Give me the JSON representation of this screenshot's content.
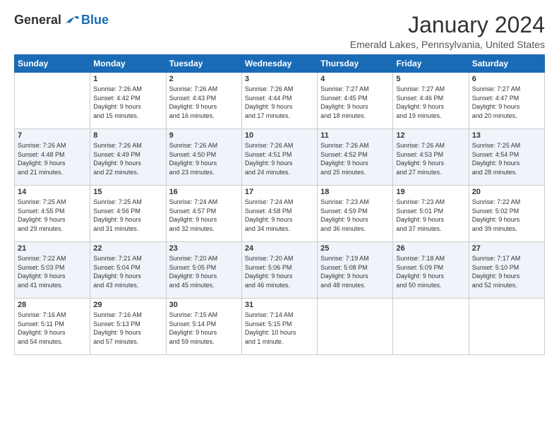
{
  "header": {
    "logo": {
      "general": "General",
      "blue": "Blue"
    },
    "title": "January 2024",
    "subtitle": "Emerald Lakes, Pennsylvania, United States"
  },
  "days_of_week": [
    "Sunday",
    "Monday",
    "Tuesday",
    "Wednesday",
    "Thursday",
    "Friday",
    "Saturday"
  ],
  "weeks": [
    {
      "stripe": false,
      "cells": [
        {
          "day": "",
          "info": ""
        },
        {
          "day": "1",
          "info": "Sunrise: 7:26 AM\nSunset: 4:42 PM\nDaylight: 9 hours\nand 15 minutes."
        },
        {
          "day": "2",
          "info": "Sunrise: 7:26 AM\nSunset: 4:43 PM\nDaylight: 9 hours\nand 16 minutes."
        },
        {
          "day": "3",
          "info": "Sunrise: 7:26 AM\nSunset: 4:44 PM\nDaylight: 9 hours\nand 17 minutes."
        },
        {
          "day": "4",
          "info": "Sunrise: 7:27 AM\nSunset: 4:45 PM\nDaylight: 9 hours\nand 18 minutes."
        },
        {
          "day": "5",
          "info": "Sunrise: 7:27 AM\nSunset: 4:46 PM\nDaylight: 9 hours\nand 19 minutes."
        },
        {
          "day": "6",
          "info": "Sunrise: 7:27 AM\nSunset: 4:47 PM\nDaylight: 9 hours\nand 20 minutes."
        }
      ]
    },
    {
      "stripe": true,
      "cells": [
        {
          "day": "7",
          "info": "Sunrise: 7:26 AM\nSunset: 4:48 PM\nDaylight: 9 hours\nand 21 minutes."
        },
        {
          "day": "8",
          "info": "Sunrise: 7:26 AM\nSunset: 4:49 PM\nDaylight: 9 hours\nand 22 minutes."
        },
        {
          "day": "9",
          "info": "Sunrise: 7:26 AM\nSunset: 4:50 PM\nDaylight: 9 hours\nand 23 minutes."
        },
        {
          "day": "10",
          "info": "Sunrise: 7:26 AM\nSunset: 4:51 PM\nDaylight: 9 hours\nand 24 minutes."
        },
        {
          "day": "11",
          "info": "Sunrise: 7:26 AM\nSunset: 4:52 PM\nDaylight: 9 hours\nand 25 minutes."
        },
        {
          "day": "12",
          "info": "Sunrise: 7:26 AM\nSunset: 4:53 PM\nDaylight: 9 hours\nand 27 minutes."
        },
        {
          "day": "13",
          "info": "Sunrise: 7:25 AM\nSunset: 4:54 PM\nDaylight: 9 hours\nand 28 minutes."
        }
      ]
    },
    {
      "stripe": false,
      "cells": [
        {
          "day": "14",
          "info": "Sunrise: 7:25 AM\nSunset: 4:55 PM\nDaylight: 9 hours\nand 29 minutes."
        },
        {
          "day": "15",
          "info": "Sunrise: 7:25 AM\nSunset: 4:56 PM\nDaylight: 9 hours\nand 31 minutes."
        },
        {
          "day": "16",
          "info": "Sunrise: 7:24 AM\nSunset: 4:57 PM\nDaylight: 9 hours\nand 32 minutes."
        },
        {
          "day": "17",
          "info": "Sunrise: 7:24 AM\nSunset: 4:58 PM\nDaylight: 9 hours\nand 34 minutes."
        },
        {
          "day": "18",
          "info": "Sunrise: 7:23 AM\nSunset: 4:59 PM\nDaylight: 9 hours\nand 36 minutes."
        },
        {
          "day": "19",
          "info": "Sunrise: 7:23 AM\nSunset: 5:01 PM\nDaylight: 9 hours\nand 37 minutes."
        },
        {
          "day": "20",
          "info": "Sunrise: 7:22 AM\nSunset: 5:02 PM\nDaylight: 9 hours\nand 39 minutes."
        }
      ]
    },
    {
      "stripe": true,
      "cells": [
        {
          "day": "21",
          "info": "Sunrise: 7:22 AM\nSunset: 5:03 PM\nDaylight: 9 hours\nand 41 minutes."
        },
        {
          "day": "22",
          "info": "Sunrise: 7:21 AM\nSunset: 5:04 PM\nDaylight: 9 hours\nand 43 minutes."
        },
        {
          "day": "23",
          "info": "Sunrise: 7:20 AM\nSunset: 5:05 PM\nDaylight: 9 hours\nand 45 minutes."
        },
        {
          "day": "24",
          "info": "Sunrise: 7:20 AM\nSunset: 5:06 PM\nDaylight: 9 hours\nand 46 minutes."
        },
        {
          "day": "25",
          "info": "Sunrise: 7:19 AM\nSunset: 5:08 PM\nDaylight: 9 hours\nand 48 minutes."
        },
        {
          "day": "26",
          "info": "Sunrise: 7:18 AM\nSunset: 5:09 PM\nDaylight: 9 hours\nand 50 minutes."
        },
        {
          "day": "27",
          "info": "Sunrise: 7:17 AM\nSunset: 5:10 PM\nDaylight: 9 hours\nand 52 minutes."
        }
      ]
    },
    {
      "stripe": false,
      "cells": [
        {
          "day": "28",
          "info": "Sunrise: 7:16 AM\nSunset: 5:11 PM\nDaylight: 9 hours\nand 54 minutes."
        },
        {
          "day": "29",
          "info": "Sunrise: 7:16 AM\nSunset: 5:13 PM\nDaylight: 9 hours\nand 57 minutes."
        },
        {
          "day": "30",
          "info": "Sunrise: 7:15 AM\nSunset: 5:14 PM\nDaylight: 9 hours\nand 59 minutes."
        },
        {
          "day": "31",
          "info": "Sunrise: 7:14 AM\nSunset: 5:15 PM\nDaylight: 10 hours\nand 1 minute."
        },
        {
          "day": "",
          "info": ""
        },
        {
          "day": "",
          "info": ""
        },
        {
          "day": "",
          "info": ""
        }
      ]
    }
  ]
}
